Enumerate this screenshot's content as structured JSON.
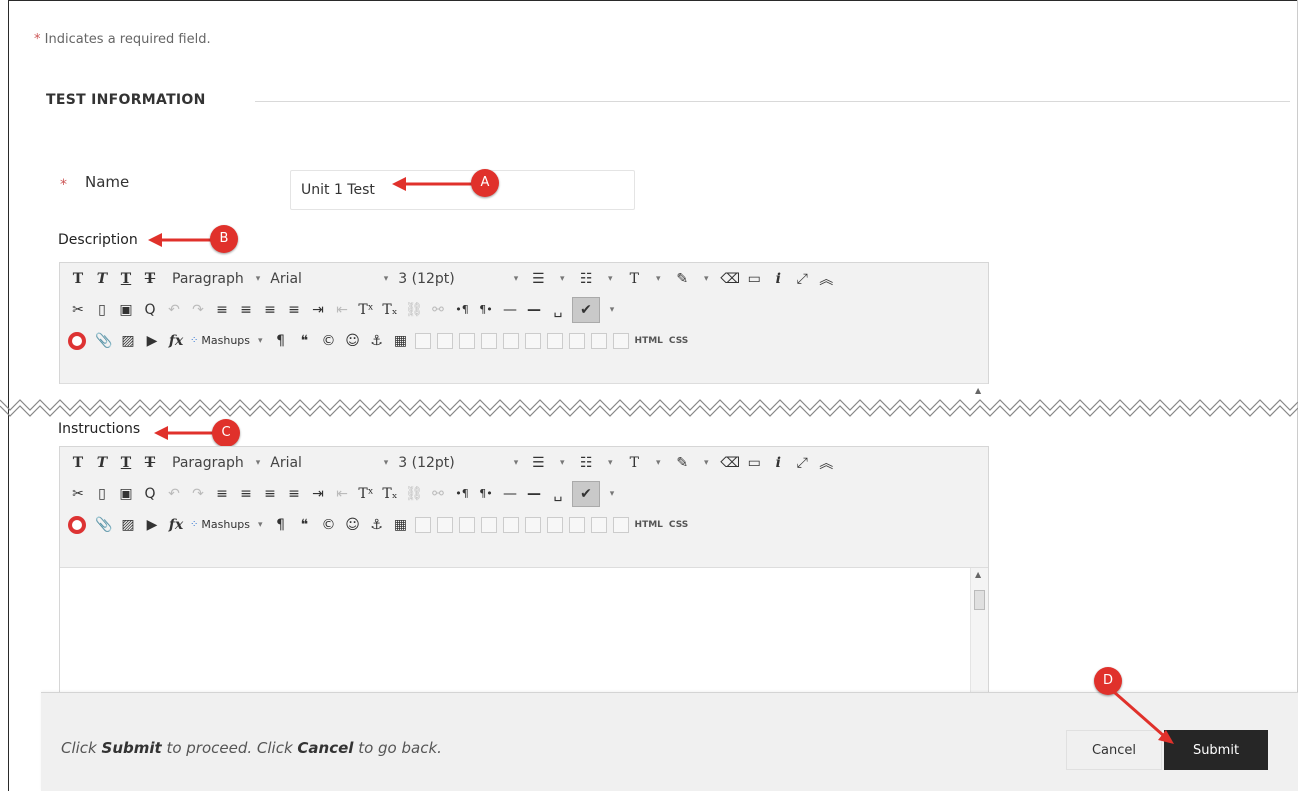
{
  "required_note": {
    "star": "*",
    "text": "Indicates a required field."
  },
  "section": {
    "title": "TEST INFORMATION"
  },
  "name_field": {
    "star": "*",
    "label": "Name",
    "value": "Unit 1 Test"
  },
  "description": {
    "label": "Description"
  },
  "instructions": {
    "label": "Instructions"
  },
  "callouts": {
    "a": "A",
    "b": "B",
    "c": "C",
    "d": "D"
  },
  "toolbar": {
    "format_block": "Paragraph",
    "font_family": "Arial",
    "font_size": "3 (12pt)",
    "mashups": "Mashups",
    "html_label": "HTML",
    "css_label": "CSS"
  },
  "footer": {
    "text_pre": "Click ",
    "text_submit": "Submit",
    "text_mid": " to proceed. Click ",
    "text_cancel": "Cancel",
    "text_post": " to go back.",
    "cancel_label": "Cancel",
    "submit_label": "Submit"
  },
  "colors": {
    "callout": "#e0312b",
    "submit_bg": "#262626",
    "footer_bg": "#f0f0f0"
  }
}
